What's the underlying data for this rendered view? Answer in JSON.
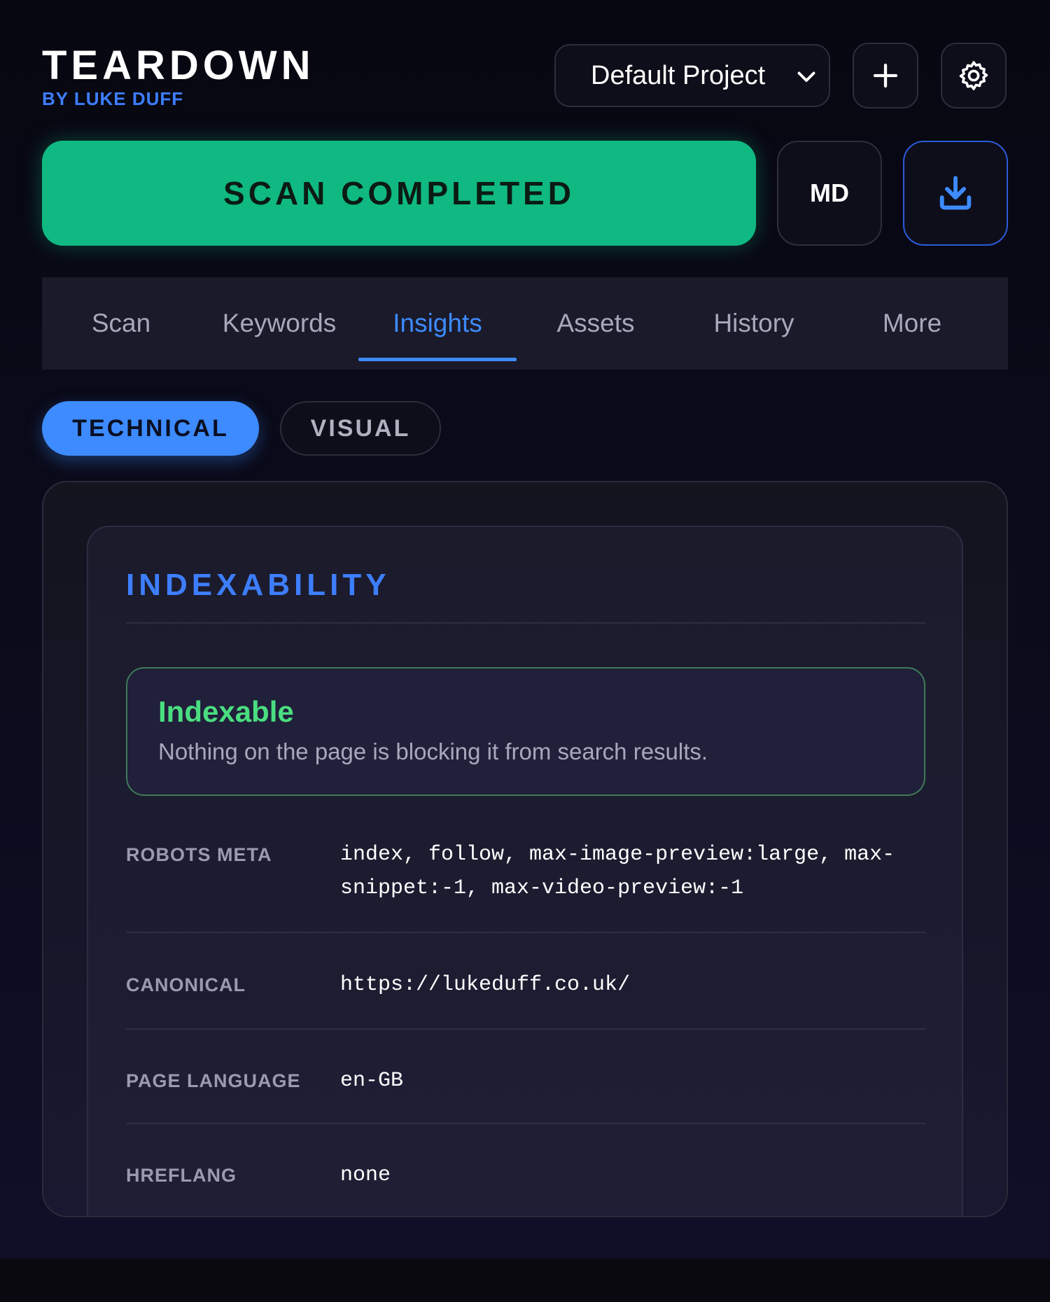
{
  "brand": {
    "title": "TEARDOWN",
    "subtitle": "BY LUKE DUFF"
  },
  "header": {
    "project_selected": "Default Project",
    "add_icon": "plus-icon",
    "settings_icon": "gear-icon"
  },
  "actions": {
    "scan_status": "SCAN COMPLETED",
    "md_label": "MD",
    "download_icon": "download-icon"
  },
  "tabs": [
    {
      "label": "Scan"
    },
    {
      "label": "Keywords"
    },
    {
      "label": "Insights",
      "active": true
    },
    {
      "label": "Assets"
    },
    {
      "label": "History"
    },
    {
      "label": "More"
    }
  ],
  "subtabs": {
    "technical": "TECHNICAL",
    "visual": "VISUAL",
    "active": "TECHNICAL"
  },
  "section": {
    "title": "INDEXABILITY",
    "status_title": "Indexable",
    "status_desc": "Nothing on the page is blocking it from search results.",
    "rows": [
      {
        "label": "ROBOTS META",
        "value": "index, follow, max-image-preview:large, max-snippet:-1, max-video-preview:-1"
      },
      {
        "label": "CANONICAL",
        "value": "https://lukeduff.co.uk/"
      },
      {
        "label": "PAGE LANGUAGE",
        "value": "en-GB"
      },
      {
        "label": "HREFLANG",
        "value": "none"
      }
    ]
  },
  "colors": {
    "accent": "#3d8bff",
    "success": "#10b981",
    "indexable_text": "#4ade80"
  }
}
